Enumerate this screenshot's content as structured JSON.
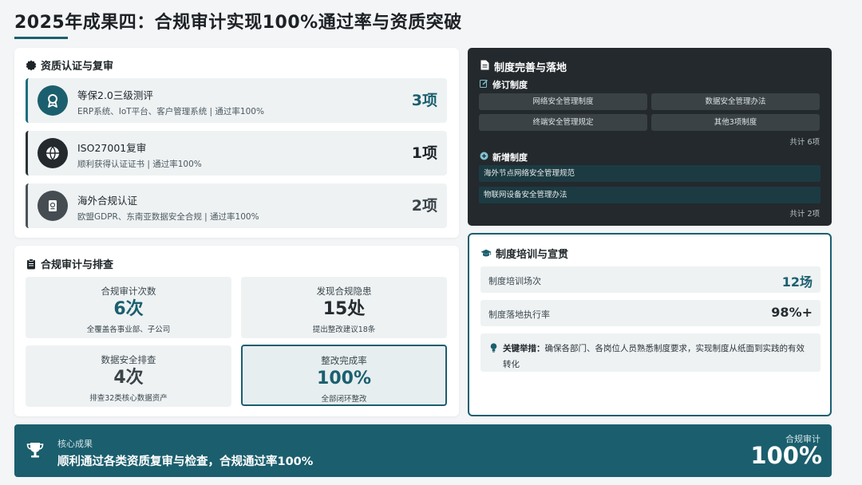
{
  "page": {
    "title": "2025年成果四：合规审计实现100%通过率与资质突破"
  },
  "qualification": {
    "heading": "资质认证与复审",
    "items": [
      {
        "name": "等保2.0三级测评",
        "desc": "ERP系统、IoT平台、客户管理系统 | 通过率100%",
        "count": "3项",
        "icon": "award-icon"
      },
      {
        "name": "ISO27001复审",
        "desc": "顺利获得认证证书 | 通过率100%",
        "count": "1项",
        "icon": "globe-icon"
      },
      {
        "name": "海外合规认证",
        "desc": "欧盟GDPR、东南亚数据安全合规 | 通过率100%",
        "count": "2项",
        "icon": "passport-icon"
      }
    ]
  },
  "audit": {
    "heading": "合规审计与排查",
    "stats": [
      {
        "label": "合规审计次数",
        "value": "6次",
        "note": "全覆盖各事业部、子公司"
      },
      {
        "label": "发现合规隐患",
        "value": "15处",
        "note": "提出整改建议18条"
      },
      {
        "label": "数据安全排查",
        "value": "4次",
        "note": "排查32类核心数据资产"
      },
      {
        "label": "整改完成率",
        "value": "100%",
        "note": "全部闭环整改"
      }
    ]
  },
  "policy": {
    "heading": "制度完善与落地",
    "revised_heading": "修订制度",
    "revised": [
      "网络安全管理制度",
      "数据安全管理办法",
      "终端安全管理规定",
      "其他3项制度"
    ],
    "revised_total": "共计 6项",
    "new_heading": "新增制度",
    "new": [
      "海外节点网络安全管理规范",
      "物联网设备安全管理办法"
    ],
    "new_total": "共计 2项"
  },
  "training": {
    "heading": "制度培训与宣贯",
    "rows": [
      {
        "label": "制度培训场次",
        "value": "12场"
      },
      {
        "label": "制度落地执行率",
        "value": "98%+"
      }
    ],
    "note_key": "关键举措：",
    "note_text": "确保各部门、各岗位人员熟悉制度要求，实现制度从纸面到实践的有效转化"
  },
  "footer": {
    "kicker": "核心成果",
    "main": "顺利通过各类资质复审与检查，合规通过率100%",
    "right_label": "合规审计",
    "right_value": "100%"
  },
  "colors": {
    "accent": "#1b5f6e",
    "dark_panel": "#23292d",
    "footer": "#1b5e6d"
  }
}
